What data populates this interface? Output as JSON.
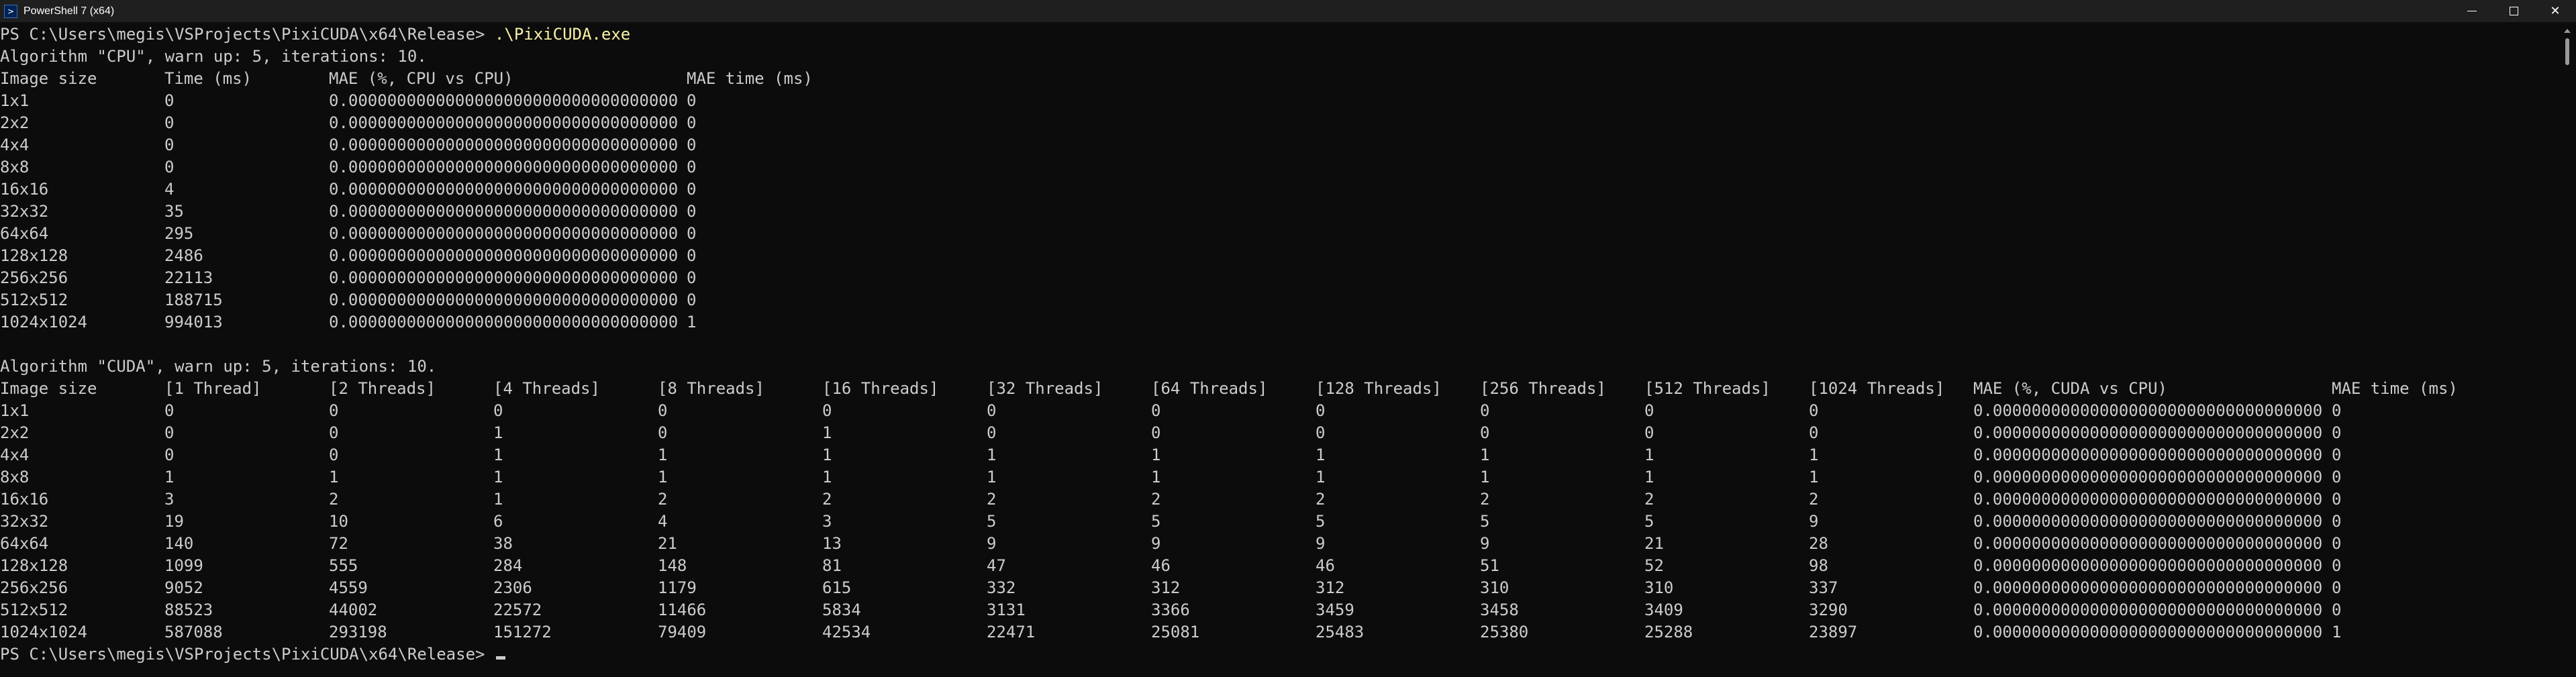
{
  "window": {
    "title": "PowerShell 7 (x64)",
    "icon": "powershell-icon",
    "app_icon_glyph": ">",
    "controls": {
      "close_glyph": "✕"
    }
  },
  "terminal": {
    "prompt_line": "PS C:\\Users\\megis\\VSProjects\\PixiCUDA\\x64\\Release> ",
    "command": ".\\PixiCUDA.exe",
    "final_prompt": "PS C:\\Users\\megis\\VSProjects\\PixiCUDA\\x64\\Release> ",
    "cpu": {
      "header": "Algorithm \"CPU\", warn up: 5, iterations: 10.",
      "columns": [
        "Image size",
        "Time (ms)",
        "MAE (%, CPU vs CPU)",
        "MAE time (ms)"
      ],
      "rows": [
        [
          "1x1",
          "0",
          "0.0000000000000000000000000000000000",
          "0"
        ],
        [
          "2x2",
          "0",
          "0.0000000000000000000000000000000000",
          "0"
        ],
        [
          "4x4",
          "0",
          "0.0000000000000000000000000000000000",
          "0"
        ],
        [
          "8x8",
          "0",
          "0.0000000000000000000000000000000000",
          "0"
        ],
        [
          "16x16",
          "4",
          "0.0000000000000000000000000000000000",
          "0"
        ],
        [
          "32x32",
          "35",
          "0.0000000000000000000000000000000000",
          "0"
        ],
        [
          "64x64",
          "295",
          "0.0000000000000000000000000000000000",
          "0"
        ],
        [
          "128x128",
          "2486",
          "0.0000000000000000000000000000000000",
          "0"
        ],
        [
          "256x256",
          "22113",
          "0.0000000000000000000000000000000000",
          "0"
        ],
        [
          "512x512",
          "188715",
          "0.0000000000000000000000000000000000",
          "0"
        ],
        [
          "1024x1024",
          "994013",
          "0.0000000000000000000000000000000000",
          "1"
        ]
      ]
    },
    "cuda": {
      "header": "Algorithm \"CUDA\", warn up: 5, iterations: 10.",
      "columns": [
        "Image size",
        "[1 Thread]",
        "[2 Threads]",
        "[4 Threads]",
        "[8 Threads]",
        "[16 Threads]",
        "[32 Threads]",
        "[64 Threads]",
        "[128 Threads]",
        "[256 Threads]",
        "[512 Threads]",
        "[1024 Threads]",
        "MAE (%, CUDA vs CPU)",
        "MAE time (ms)"
      ],
      "rows": [
        [
          "1x1",
          "0",
          "0",
          "0",
          "0",
          "0",
          "0",
          "0",
          "0",
          "0",
          "0",
          "0",
          "0.0000000000000000000000000000000000",
          "0"
        ],
        [
          "2x2",
          "0",
          "0",
          "1",
          "0",
          "1",
          "0",
          "0",
          "0",
          "0",
          "0",
          "0",
          "0.0000000000000000000000000000000000",
          "0"
        ],
        [
          "4x4",
          "0",
          "0",
          "1",
          "1",
          "1",
          "1",
          "1",
          "1",
          "1",
          "1",
          "1",
          "0.0000000000000000000000000000000000",
          "0"
        ],
        [
          "8x8",
          "1",
          "1",
          "1",
          "1",
          "1",
          "1",
          "1",
          "1",
          "1",
          "1",
          "1",
          "0.0000000000000000000000000000000000",
          "0"
        ],
        [
          "16x16",
          "3",
          "2",
          "1",
          "2",
          "2",
          "2",
          "2",
          "2",
          "2",
          "2",
          "2",
          "0.0000000000000000000000000000000000",
          "0"
        ],
        [
          "32x32",
          "19",
          "10",
          "6",
          "4",
          "3",
          "5",
          "5",
          "5",
          "5",
          "5",
          "9",
          "0.0000000000000000000000000000000000",
          "0"
        ],
        [
          "64x64",
          "140",
          "72",
          "38",
          "21",
          "13",
          "9",
          "9",
          "9",
          "9",
          "21",
          "28",
          "0.0000000000000000000000000000000000",
          "0"
        ],
        [
          "128x128",
          "1099",
          "555",
          "284",
          "148",
          "81",
          "47",
          "46",
          "46",
          "51",
          "52",
          "98",
          "0.0000000000000000000000000000000000",
          "0"
        ],
        [
          "256x256",
          "9052",
          "4559",
          "2306",
          "1179",
          "615",
          "332",
          "312",
          "312",
          "310",
          "310",
          "337",
          "0.0000000000000000000000000000000000",
          "0"
        ],
        [
          "512x512",
          "88523",
          "44002",
          "22572",
          "11466",
          "5834",
          "3131",
          "3366",
          "3459",
          "3458",
          "3409",
          "3290",
          "0.0000000000000000000000000000000000",
          "0"
        ],
        [
          "1024x1024",
          "587088",
          "293198",
          "151272",
          "79409",
          "42534",
          "22471",
          "25081",
          "25483",
          "25380",
          "25288",
          "23897",
          "0.0000000000000000000000000000000000",
          "1"
        ]
      ]
    }
  },
  "colors": {
    "background": "#0c0c0c",
    "text": "#cccccc",
    "command": "#f9f1a5",
    "titlebar": "#1f1f1f"
  }
}
